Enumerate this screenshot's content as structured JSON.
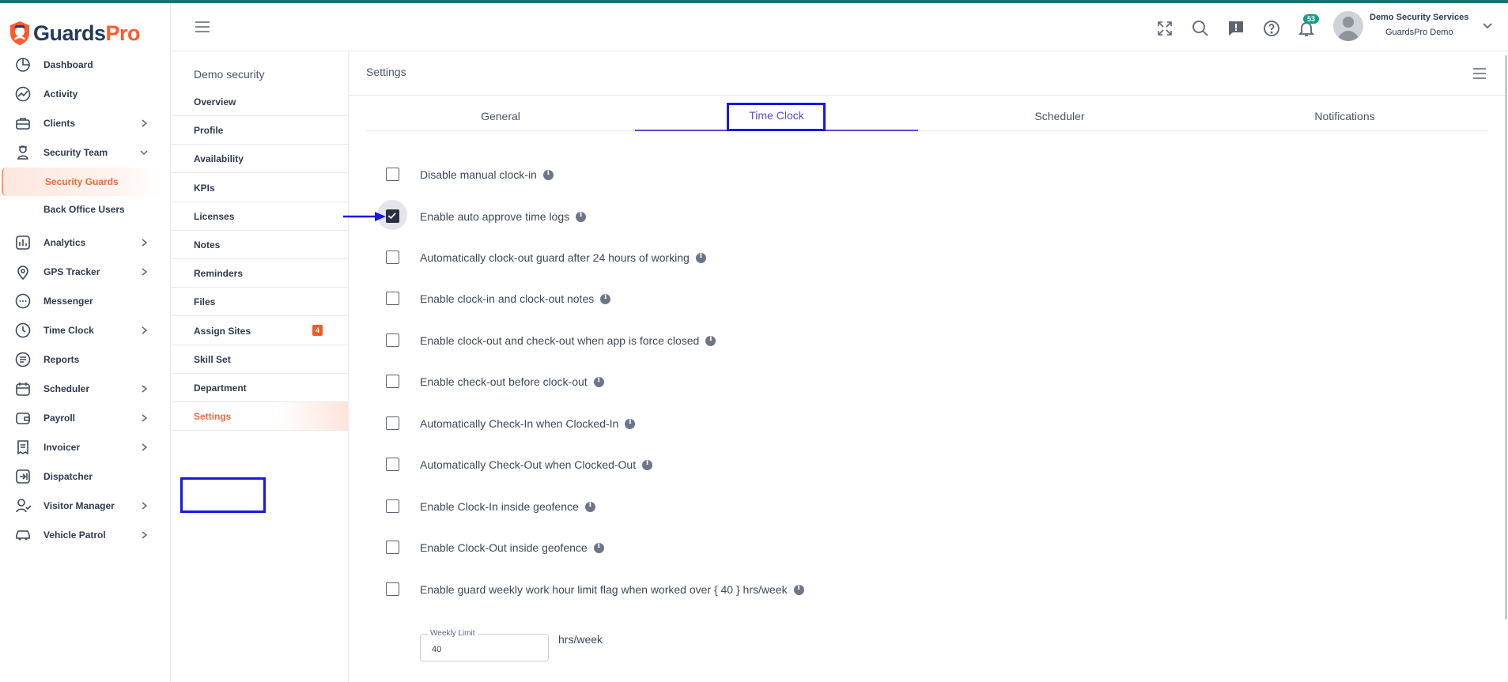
{
  "brand": {
    "part1": "Guards",
    "part2": "Pro"
  },
  "nav": {
    "items": [
      {
        "label": "Dashboard",
        "icon": "dashboard-icon"
      },
      {
        "label": "Activity",
        "icon": "activity-icon"
      },
      {
        "label": "Clients",
        "icon": "briefcase-icon",
        "chevron": "right"
      },
      {
        "label": "Security Team",
        "icon": "guard-icon",
        "chevron": "down"
      },
      {
        "label": "Security Guards",
        "sub": true,
        "active": true
      },
      {
        "label": "Back Office Users",
        "sub": true
      },
      {
        "label": "Analytics",
        "icon": "analytics-icon",
        "chevron": "right"
      },
      {
        "label": "GPS Tracker",
        "icon": "location-pin-icon",
        "chevron": "right"
      },
      {
        "label": "Messenger",
        "icon": "chat-icon"
      },
      {
        "label": "Time Clock",
        "icon": "clock-icon",
        "chevron": "right"
      },
      {
        "label": "Reports",
        "icon": "reports-icon"
      },
      {
        "label": "Scheduler",
        "icon": "calendar-icon",
        "chevron": "right"
      },
      {
        "label": "Payroll",
        "icon": "wallet-icon",
        "chevron": "right"
      },
      {
        "label": "Invoicer",
        "icon": "invoice-icon",
        "chevron": "right"
      },
      {
        "label": "Dispatcher",
        "icon": "dispatch-icon"
      },
      {
        "label": "Visitor Manager",
        "icon": "visitor-icon",
        "chevron": "right"
      },
      {
        "label": "Vehicle Patrol",
        "icon": "car-icon",
        "chevron": "right"
      }
    ]
  },
  "header": {
    "notification_count": "53",
    "user_name": "Demo Security Services",
    "user_org": "GuardsPro Demo"
  },
  "subnav": {
    "title": "Demo security",
    "items": [
      {
        "label": "Overview"
      },
      {
        "label": "Profile"
      },
      {
        "label": "Availability"
      },
      {
        "label": "KPIs"
      },
      {
        "label": "Licenses"
      },
      {
        "label": "Notes"
      },
      {
        "label": "Reminders"
      },
      {
        "label": "Files"
      },
      {
        "label": "Assign Sites",
        "badge": "4"
      },
      {
        "label": "Skill Set"
      },
      {
        "label": "Department"
      },
      {
        "label": "Settings",
        "active": true
      }
    ]
  },
  "main": {
    "title": "Settings",
    "tabs": [
      "General",
      "Time Clock",
      "Scheduler",
      "Notifications"
    ],
    "active_tab": "Time Clock",
    "options": [
      {
        "label": "Disable manual clock-in",
        "checked": false
      },
      {
        "label": "Enable auto approve time logs",
        "checked": true
      },
      {
        "label": "Automatically clock-out guard after 24 hours of working",
        "checked": false
      },
      {
        "label": "Enable clock-in and clock-out notes",
        "checked": false
      },
      {
        "label": "Enable clock-out and check-out when app is force closed",
        "checked": false
      },
      {
        "label": "Enable check-out before clock-out",
        "checked": false
      },
      {
        "label": "Automatically Check-In when Clocked-In",
        "checked": false
      },
      {
        "label": "Automatically Check-Out when Clocked-Out",
        "checked": false
      },
      {
        "label": "Enable Clock-In inside geofence",
        "checked": false
      },
      {
        "label": "Enable Clock-Out inside geofence",
        "checked": false
      },
      {
        "label": "Enable guard weekly work hour limit flag when worked over { 40 } hrs/week",
        "checked": false
      }
    ],
    "weekly_limit": {
      "label": "Weekly Limit",
      "value": "40",
      "unit": "hrs/week"
    }
  },
  "colors": {
    "brand_navy": "#243a5e",
    "brand_orange": "#ff5a2c",
    "accent": "#5b48d6",
    "highlight": "#1717e6"
  }
}
